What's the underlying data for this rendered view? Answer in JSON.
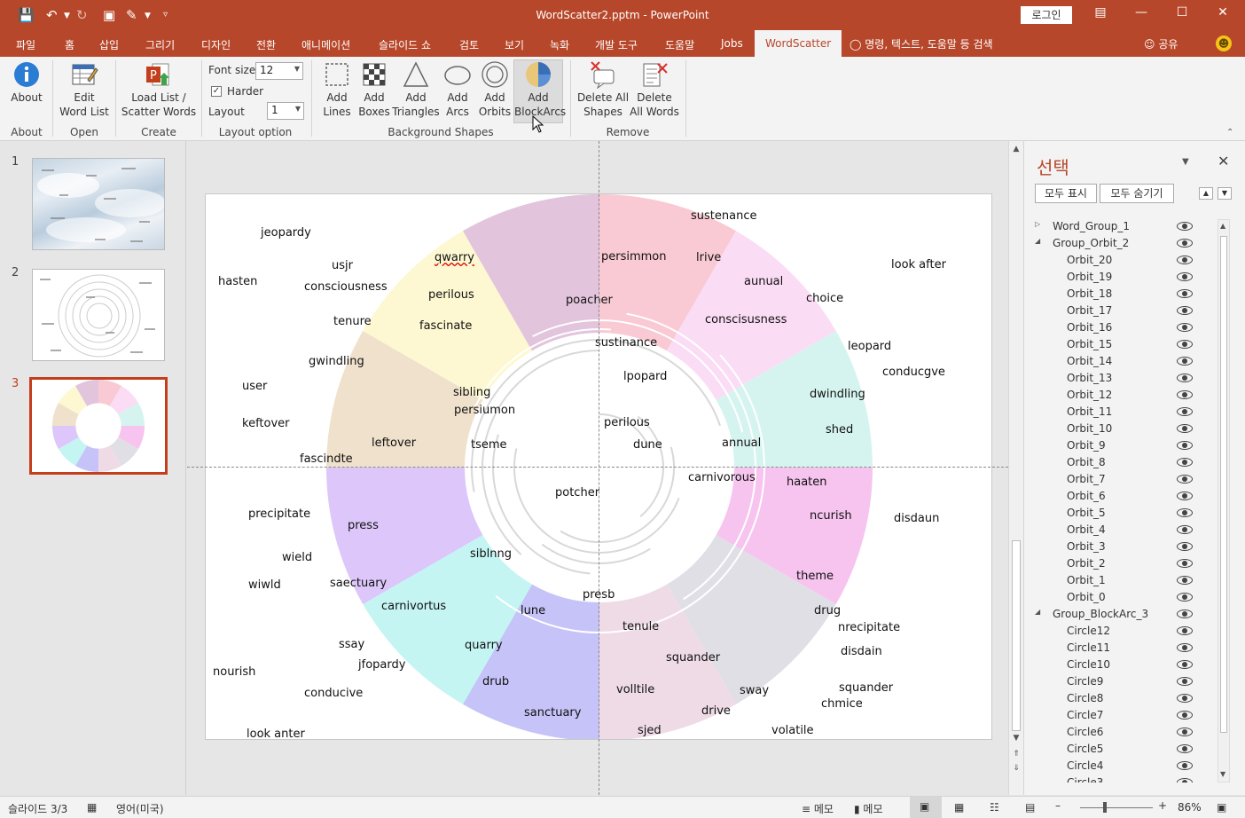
{
  "window": {
    "title": "WordScatter2.pptm - PowerPoint",
    "login_label": "로그인",
    "accent_color": "#b7472a"
  },
  "tabs": [
    {
      "label": "파일"
    },
    {
      "label": "홈"
    },
    {
      "label": "삽입"
    },
    {
      "label": "그리기"
    },
    {
      "label": "디자인"
    },
    {
      "label": "전환"
    },
    {
      "label": "애니메이션"
    },
    {
      "label": "슬라이드 쇼"
    },
    {
      "label": "검토"
    },
    {
      "label": "보기"
    },
    {
      "label": "녹화"
    },
    {
      "label": "개발 도구"
    },
    {
      "label": "도움말"
    },
    {
      "label": "Jobs"
    },
    {
      "label": "WordScatter"
    }
  ],
  "search_label": "명령, 텍스트, 도움말 등 검색",
  "share_label": "공유",
  "ribbon": {
    "about": {
      "button": "About",
      "group": "About"
    },
    "open": {
      "button_line1": "Edit",
      "button_line2": "Word List",
      "group": "Open"
    },
    "create": {
      "button_line1": "Load List /",
      "button_line2": "Scatter Words",
      "group": "Create"
    },
    "layout": {
      "font_size_label": "Font size",
      "font_size_value": "12",
      "harder_label": "Harder",
      "harder_checked": true,
      "layout_label": "Layout",
      "layout_value": "1",
      "group": "Layout option"
    },
    "shapes": {
      "buttons": [
        {
          "line1": "Add",
          "line2": "Lines"
        },
        {
          "line1": "Add",
          "line2": "Boxes"
        },
        {
          "line1": "Add",
          "line2": "Triangles"
        },
        {
          "line1": "Add",
          "line2": "Arcs"
        },
        {
          "line1": "Add",
          "line2": "Orbits"
        },
        {
          "line1": "Add",
          "line2": "BlockArcs"
        }
      ],
      "group": "Background Shapes"
    },
    "remove": {
      "buttons": [
        {
          "line1": "Delete All",
          "line2": "Shapes"
        },
        {
          "line1": "Delete",
          "line2": "All Words"
        }
      ],
      "group": "Remove"
    }
  },
  "slides": [
    {
      "number": "1",
      "background": "cloud-sky"
    },
    {
      "number": "2",
      "background": "orbits"
    },
    {
      "number": "3",
      "background": "blockarcs",
      "selected": true
    }
  ],
  "block_arc_colors": [
    "#f9cad3",
    "#fbdcf5",
    "#d6f4ef",
    "#f6c4ee",
    "#e1dfe6",
    "#efdbe6",
    "#c5c3f7",
    "#c4f5f3",
    "#dcc6fa",
    "#f0e1cc",
    "#fdf8d1",
    "#e2c4dc"
  ],
  "words": [
    {
      "text": "jeopardy"
    },
    {
      "text": "usjr"
    },
    {
      "text": "qwarry",
      "wavy": true
    },
    {
      "text": "persimmon"
    },
    {
      "text": "lrive"
    },
    {
      "text": "sustenance"
    },
    {
      "text": "look after"
    },
    {
      "text": "hasten"
    },
    {
      "text": "consciousness"
    },
    {
      "text": "perilous"
    },
    {
      "text": "poacher"
    },
    {
      "text": "aunual"
    },
    {
      "text": "choice"
    },
    {
      "text": "tenure"
    },
    {
      "text": "fascinate"
    },
    {
      "text": "conscisusness"
    },
    {
      "text": "sustinance"
    },
    {
      "text": "leopard"
    },
    {
      "text": "gwindling"
    },
    {
      "text": "conducgve"
    },
    {
      "text": "lpopard"
    },
    {
      "text": "user"
    },
    {
      "text": "sibling"
    },
    {
      "text": "dwindling"
    },
    {
      "text": "persiumon"
    },
    {
      "text": "perilous"
    },
    {
      "text": "keftover"
    },
    {
      "text": "shed"
    },
    {
      "text": "leftover"
    },
    {
      "text": "tseme"
    },
    {
      "text": "dune"
    },
    {
      "text": "annual"
    },
    {
      "text": "fascindte"
    },
    {
      "text": "carnivorous"
    },
    {
      "text": "haaten"
    },
    {
      "text": "potcher"
    },
    {
      "text": "precipitate"
    },
    {
      "text": "ncurish"
    },
    {
      "text": "disdaun"
    },
    {
      "text": "press"
    },
    {
      "text": "siblnng"
    },
    {
      "text": "wield"
    },
    {
      "text": "theme"
    },
    {
      "text": "wiwld"
    },
    {
      "text": "saectuary"
    },
    {
      "text": "presb"
    },
    {
      "text": "carnivortus"
    },
    {
      "text": "lune"
    },
    {
      "text": "drug"
    },
    {
      "text": "nrecipitate"
    },
    {
      "text": "tenule"
    },
    {
      "text": "ssay"
    },
    {
      "text": "quarry"
    },
    {
      "text": "disdain"
    },
    {
      "text": "jfopardy"
    },
    {
      "text": "squander"
    },
    {
      "text": "nourish"
    },
    {
      "text": "drub"
    },
    {
      "text": "volltile"
    },
    {
      "text": "sway"
    },
    {
      "text": "squander"
    },
    {
      "text": "conducive"
    },
    {
      "text": "chmice"
    },
    {
      "text": "sanctuary"
    },
    {
      "text": "drive"
    },
    {
      "text": "look anter"
    },
    {
      "text": "sjed"
    },
    {
      "text": "volatile"
    }
  ],
  "selection_pane": {
    "title": "선택",
    "show_all": "모두 표시",
    "hide_all": "모두 숨기기",
    "items": [
      {
        "label": "Word_Group_1",
        "level": 0,
        "caret": "▷"
      },
      {
        "label": "Group_Orbit_2",
        "level": 0,
        "caret": "◢"
      },
      {
        "label": "Orbit_20",
        "level": 1
      },
      {
        "label": "Orbit_19",
        "level": 1
      },
      {
        "label": "Orbit_18",
        "level": 1
      },
      {
        "label": "Orbit_17",
        "level": 1
      },
      {
        "label": "Orbit_16",
        "level": 1
      },
      {
        "label": "Orbit_15",
        "level": 1
      },
      {
        "label": "Orbit_14",
        "level": 1
      },
      {
        "label": "Orbit_13",
        "level": 1
      },
      {
        "label": "Orbit_12",
        "level": 1
      },
      {
        "label": "Orbit_11",
        "level": 1
      },
      {
        "label": "Orbit_10",
        "level": 1
      },
      {
        "label": "Orbit_9",
        "level": 1
      },
      {
        "label": "Orbit_8",
        "level": 1
      },
      {
        "label": "Orbit_7",
        "level": 1
      },
      {
        "label": "Orbit_6",
        "level": 1
      },
      {
        "label": "Orbit_5",
        "level": 1
      },
      {
        "label": "Orbit_4",
        "level": 1
      },
      {
        "label": "Orbit_3",
        "level": 1
      },
      {
        "label": "Orbit_2",
        "level": 1
      },
      {
        "label": "Orbit_1",
        "level": 1
      },
      {
        "label": "Orbit_0",
        "level": 1
      },
      {
        "label": "Group_BlockArc_3",
        "level": 0,
        "caret": "◢"
      },
      {
        "label": "Circle12",
        "level": 1
      },
      {
        "label": "Circle11",
        "level": 1
      },
      {
        "label": "Circle10",
        "level": 1
      },
      {
        "label": "Circle9",
        "level": 1
      },
      {
        "label": "Circle8",
        "level": 1
      },
      {
        "label": "Circle7",
        "level": 1
      },
      {
        "label": "Circle6",
        "level": 1
      },
      {
        "label": "Circle5",
        "level": 1
      },
      {
        "label": "Circle4",
        "level": 1
      },
      {
        "label": "Circle3",
        "level": 1
      }
    ]
  },
  "status": {
    "slide_counter": "슬라이드 3/3",
    "language": "영어(미국)",
    "notes_label": "메모",
    "comments_label": "메모",
    "zoom": "86%"
  }
}
